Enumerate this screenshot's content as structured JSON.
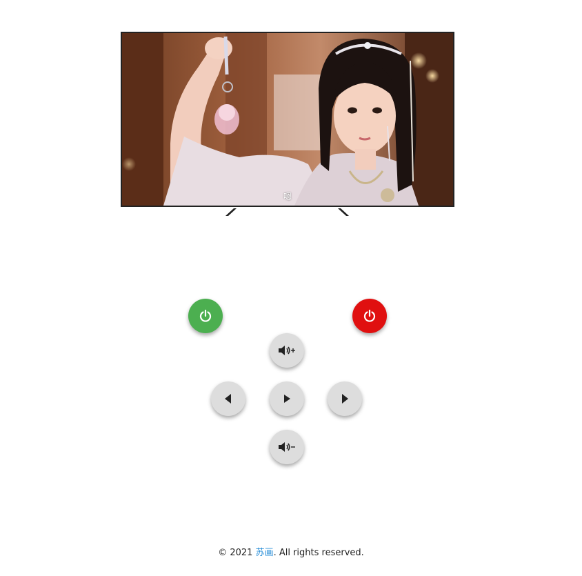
{
  "tv": {
    "subtitle": "嗯",
    "screen_image": "drama-still-girl-holding-keychain"
  },
  "remote": {
    "buttons": [
      {
        "name": "power-on-button",
        "icon": "power-icon",
        "color": "#4caf50"
      },
      {
        "name": "power-off-button",
        "icon": "power-icon",
        "color": "#e01010"
      },
      {
        "name": "volume-up-button",
        "icon": "volume-up-icon"
      },
      {
        "name": "previous-channel-button",
        "icon": "triangle-left-icon"
      },
      {
        "name": "play-button",
        "icon": "play-icon"
      },
      {
        "name": "next-channel-button",
        "icon": "triangle-right-icon"
      },
      {
        "name": "volume-down-button",
        "icon": "volume-down-icon"
      }
    ]
  },
  "footer": {
    "prefix": "© 2021 ",
    "link_text": "苏画",
    "suffix": ". All rights reserved."
  },
  "colors": {
    "accent_link": "#2a8fd8",
    "button_grey": "#dddddd"
  }
}
